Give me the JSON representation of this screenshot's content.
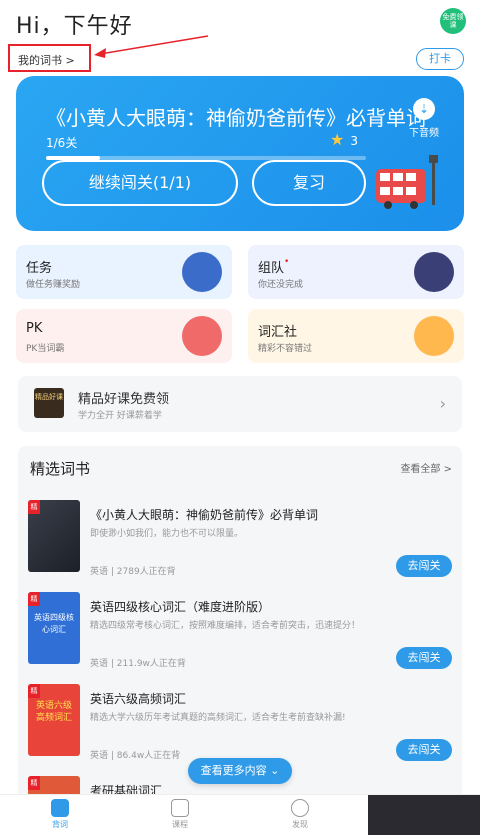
{
  "header": {
    "greeting": "Hi，下午好",
    "gift_badge": "免费领课"
  },
  "my_books": {
    "label": "我的词书 >"
  },
  "checkin": {
    "label": "打卡"
  },
  "hero": {
    "title": "《小黄人大眼萌：神偷奶爸前传》必背单词",
    "progress_text": "1/6关",
    "progress_fraction": 0.17,
    "stars": "3",
    "download_label": "下音频",
    "continue_label": "继续闯关(1/1)",
    "review_label": "复习"
  },
  "cards": [
    {
      "title": "任务",
      "sub": "做任务赚奖励",
      "bg": "#e9f3ff",
      "icon": "crown-icon",
      "icon_bg": "#3b6cc9"
    },
    {
      "title": "组队",
      "sub": "你还没完成",
      "bg": "#eef2ff",
      "icon": "team-icon",
      "icon_bg": "#3a3f75",
      "dot": "•"
    },
    {
      "title": "PK",
      "sub": "PK当词霸",
      "bg": "#fff0f0",
      "icon": "pk-icon",
      "icon_bg": "#f06a6a"
    },
    {
      "title": "词汇社",
      "sub": "精彩不容错过",
      "bg": "#fff6e6",
      "icon": "club-icon",
      "icon_bg": "#ffb84d"
    }
  ],
  "promo": {
    "thumb_text": "精品好课",
    "title": "精品好课免费领",
    "sub": "学力全开 好课薪着学"
  },
  "section": {
    "title": "精选词书",
    "view_all": "查看全部 >"
  },
  "books": [
    {
      "tag": "精",
      "title": "《小黄人大眼萌：神偷奶爸前传》必背单词",
      "desc": "即使渺小如我们，能力也不可以限量。",
      "lang": "英语",
      "count": "2789人正在背",
      "button": "去闯关"
    },
    {
      "tag": "精",
      "cover_text": "英语四级核心词汇",
      "title": "英语四级核心词汇（难度进阶版）",
      "desc": "精选四级常考核心词汇，按照难度编排，适合考前突击，迅速提分！",
      "lang": "英语",
      "count": "211.9w人正在背",
      "button": "去闯关"
    },
    {
      "tag": "精",
      "cover_text": "英语六级高频词汇",
      "title": "英语六级高频词汇",
      "desc": "精选大学六级历年考试真题的高频词汇，适合考生考前查缺补漏!",
      "lang": "英语",
      "count": "86.4w人正在背",
      "button": "去闯关"
    },
    {
      "tag": "精",
      "title": "考研基础词汇"
    }
  ],
  "more_button": "查看更多内容 ⌄",
  "tabs": [
    {
      "label": "背词",
      "icon": "vocab-icon",
      "active": true
    },
    {
      "label": "课程",
      "icon": "course-icon",
      "active": false
    },
    {
      "label": "发现",
      "icon": "discover-icon",
      "active": false
    }
  ],
  "colors": {
    "accent": "#2f9be8",
    "hero": "#2aa6f2",
    "highlight_box": "#e8222a"
  }
}
